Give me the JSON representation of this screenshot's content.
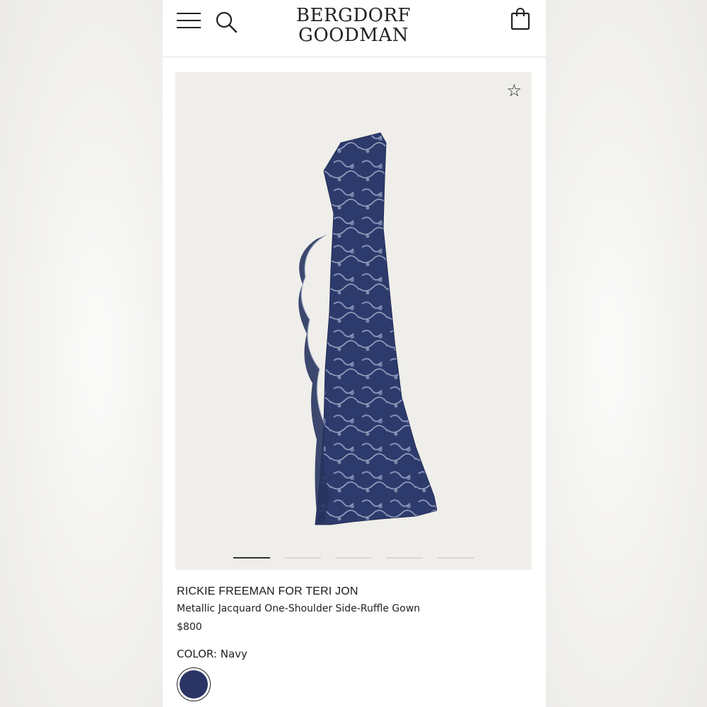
{
  "header": {
    "logo_line1": "BERGDORF",
    "logo_line2": "GOODMAN",
    "menu_icon": "hamburger-menu-icon",
    "search_icon": "search-icon",
    "bag_icon": "shopping-bag-icon"
  },
  "gallery": {
    "favorite_icon": "star-outline-icon",
    "favorite_glyph": "☆",
    "slide_count": 5,
    "active_slide": 1
  },
  "product": {
    "brand": "RICKIE FREEMAN FOR TERI JON",
    "name": "Metallic Jacquard One-Shoulder Side-Ruffle Gown",
    "price": "$800",
    "color_label": "COLOR:",
    "color_value": "Navy",
    "swatch_color": "#2a3566"
  },
  "colors": {
    "dress_navy": "#2f3b6e",
    "dress_highlight": "#c9cfe0"
  }
}
